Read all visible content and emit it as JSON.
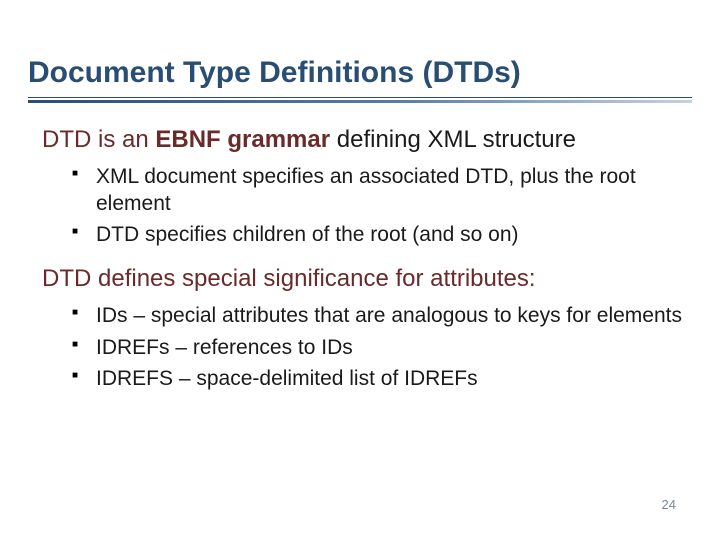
{
  "title": "Document Type Definitions (DTDs)",
  "section1": {
    "head_prefix": "DTD is an ",
    "head_keyword": "EBNF grammar",
    "head_suffix": " defining XML structure",
    "bullets": [
      "XML document specifies an associated DTD, plus the root element",
      "DTD specifies children of the root (and so on)"
    ]
  },
  "section2": {
    "head": "DTD defines special significance for attributes:",
    "bullets": [
      "IDs – special attributes that are analogous to keys for elements",
      "IDREFs – references to IDs",
      "IDREFS – space-delimited list of IDREFs"
    ]
  },
  "page_number": "24"
}
